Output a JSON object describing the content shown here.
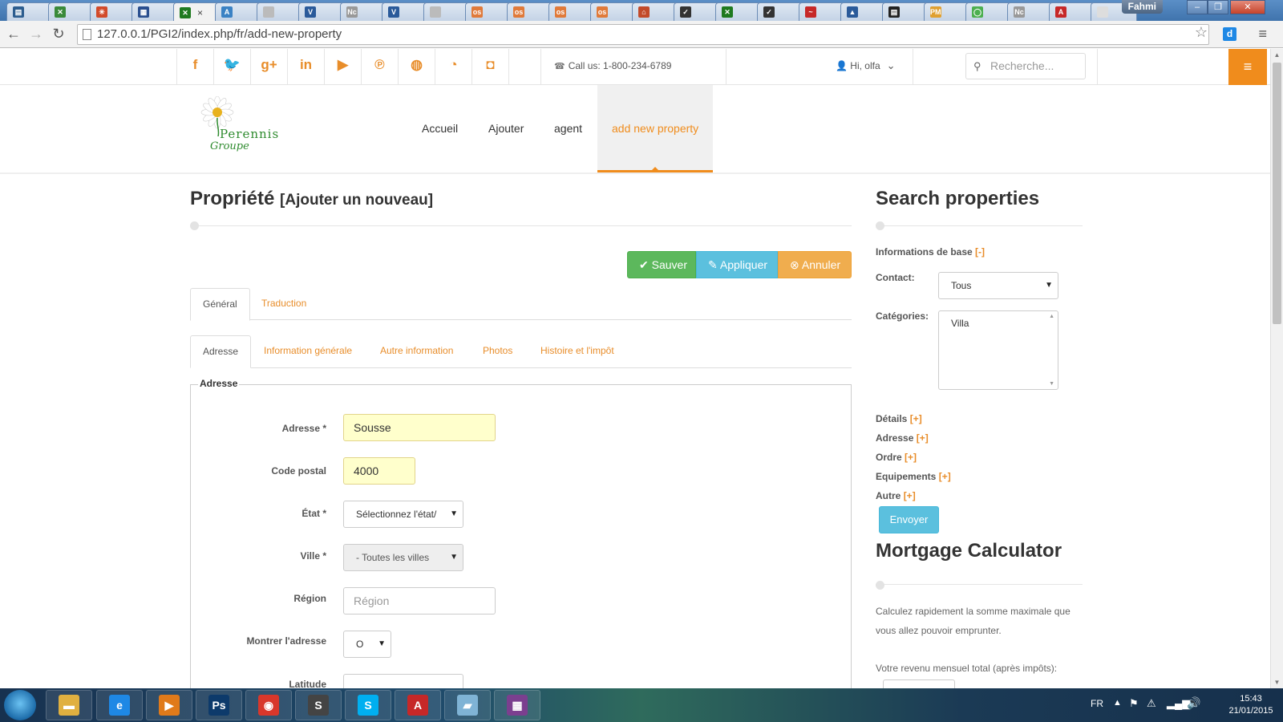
{
  "browser": {
    "url": "127.0.0.1/PGI2/index.php/fr/add-new-property",
    "user_badge": "Fahmi",
    "tabs": [
      {
        "icon": "page-icon",
        "color": "#2c5d8f",
        "glyph": "▤"
      },
      {
        "icon": "joomla-icon",
        "color": "#3a8a3a",
        "glyph": "✕"
      },
      {
        "icon": "joomla-icon",
        "color": "#d24a2a",
        "glyph": "✳"
      },
      {
        "icon": "grid-icon",
        "color": "#2a4f8f",
        "glyph": "▦"
      },
      {
        "icon": "joomla-icon",
        "color": "#1f7a1f",
        "glyph": "✕"
      },
      {
        "icon": "translate-icon",
        "color": "#3b82c4",
        "glyph": "A"
      },
      {
        "icon": "blank-page-icon",
        "color": "#bbbbbb",
        "glyph": ""
      },
      {
        "icon": "vsite-icon",
        "color": "#2a5a9a",
        "glyph": "V"
      },
      {
        "icon": "nc-icon",
        "color": "#999999",
        "glyph": "Nc"
      },
      {
        "icon": "vsite-icon",
        "color": "#2a5a9a",
        "glyph": "V"
      },
      {
        "icon": "blank-page-icon",
        "color": "#bbbbbb",
        "glyph": ""
      },
      {
        "icon": "os-icon",
        "color": "#e07a3a",
        "glyph": "os"
      },
      {
        "icon": "os-icon",
        "color": "#e07a3a",
        "glyph": "os"
      },
      {
        "icon": "os-icon",
        "color": "#e07a3a",
        "glyph": "os"
      },
      {
        "icon": "os-icon",
        "color": "#e07a3a",
        "glyph": "os"
      },
      {
        "icon": "home-icon",
        "color": "#c24a2a",
        "glyph": "⌂"
      },
      {
        "icon": "check-circle-icon",
        "color": "#333333",
        "glyph": "✓"
      },
      {
        "icon": "joomla-icon",
        "color": "#1f7a1f",
        "glyph": "✕"
      },
      {
        "icon": "check-circle-icon",
        "color": "#333333",
        "glyph": "✓"
      },
      {
        "icon": "wave-icon",
        "color": "#c62828",
        "glyph": "~"
      },
      {
        "icon": "triangle-icon",
        "color": "#2a5a9a",
        "glyph": "▲"
      },
      {
        "icon": "dark-page-icon",
        "color": "#222222",
        "glyph": "▤"
      },
      {
        "icon": "pma-icon",
        "color": "#e0a030",
        "glyph": "PMA"
      },
      {
        "icon": "ring-icon",
        "color": "#4caf50",
        "glyph": "◯"
      },
      {
        "icon": "nc-icon",
        "color": "#999999",
        "glyph": "Nc"
      },
      {
        "icon": "acrobat-icon",
        "color": "#c62828",
        "glyph": "A"
      },
      {
        "icon": "blank-tab-icon",
        "color": "#dddddd",
        "glyph": ""
      }
    ],
    "close_tab": "×"
  },
  "topbar": {
    "social": [
      {
        "name": "facebook-icon",
        "glyph": "f"
      },
      {
        "name": "twitter-icon",
        "glyph": "🐦"
      },
      {
        "name": "google-plus-icon",
        "glyph": "g+"
      },
      {
        "name": "linkedin-icon",
        "glyph": "in"
      },
      {
        "name": "youtube-icon",
        "glyph": "▶"
      },
      {
        "name": "pinterest-icon",
        "glyph": "℗"
      },
      {
        "name": "dribbble-icon",
        "glyph": "◍"
      },
      {
        "name": "rss-icon",
        "glyph": "◔"
      },
      {
        "name": "instagram-icon",
        "glyph": "◘"
      }
    ],
    "call_us": "Call us: 1-800-234-6789",
    "greeting": "Hi, olfa",
    "search_placeholder": "Recherche..."
  },
  "nav": {
    "items": [
      "Accueil",
      "Ajouter",
      "agent",
      "add new property"
    ],
    "logo_text_1": "Perennis",
    "logo_text_2": "Groupe"
  },
  "main": {
    "title": "Propriété",
    "subtitle": "[Ajouter un nouveau]",
    "buttons": {
      "save": "Sauver",
      "apply": "Appliquer",
      "cancel": "Annuler"
    },
    "tabs": [
      "Général",
      "Traduction"
    ],
    "subtabs": [
      "Adresse",
      "Information générale",
      "Autre information",
      "Photos",
      "Histoire et l'impôt"
    ],
    "fieldset_legend": "Adresse",
    "fields": {
      "address": {
        "label": "Adresse *",
        "value": "Sousse"
      },
      "postal": {
        "label": "Code postal",
        "value": "4000"
      },
      "state": {
        "label": "État *",
        "value": "Sélectionnez l'état/"
      },
      "city": {
        "label": "Ville *",
        "value": "- Toutes les villes"
      },
      "region": {
        "label": "Région",
        "placeholder": "Région"
      },
      "show_address": {
        "label": "Montrer l'adresse",
        "value": "O"
      },
      "latitude": {
        "label": "Latitude"
      }
    }
  },
  "sidebar": {
    "title": "Search properties",
    "basic_info": "Informations de base",
    "basic_toggle": "[-]",
    "contact_label": "Contact:",
    "contact_value": "Tous",
    "categories_label": "Catégories:",
    "categories_value": "Villa",
    "sections": [
      {
        "label": "Détails",
        "toggle": "[+]"
      },
      {
        "label": "Adresse",
        "toggle": "[+]"
      },
      {
        "label": "Ordre",
        "toggle": "[+]"
      },
      {
        "label": "Equipements",
        "toggle": "[+]"
      },
      {
        "label": "Autre",
        "toggle": "[+]"
      }
    ],
    "submit": "Envoyer",
    "mortgage_title": "Mortgage Calculator",
    "mortgage_text_1": "Calculez rapidement la somme maximale que",
    "mortgage_text_2": "vous allez pouvoir emprunter.",
    "income_label": "Votre revenu mensuel total (après impôts):"
  },
  "taskbar": {
    "apps": [
      {
        "name": "explorer-icon",
        "color": "#e0b040",
        "glyph": "▬"
      },
      {
        "name": "ie-icon",
        "color": "#1e88e5",
        "glyph": "e"
      },
      {
        "name": "media-player-icon",
        "color": "#e07a1a",
        "glyph": "▶"
      },
      {
        "name": "photoshop-icon",
        "color": "#0d3a6b",
        "glyph": "Ps"
      },
      {
        "name": "chrome-icon",
        "color": "#d8372b",
        "glyph": "◉"
      },
      {
        "name": "sublime-icon",
        "color": "#444444",
        "glyph": "S"
      },
      {
        "name": "skype-icon",
        "color": "#00aff0",
        "glyph": "S"
      },
      {
        "name": "acrobat-icon",
        "color": "#c62828",
        "glyph": "A"
      },
      {
        "name": "notepad-icon",
        "color": "#7fb3d5",
        "glyph": "▰"
      },
      {
        "name": "winrar-icon",
        "color": "#7b3f8f",
        "glyph": "▦"
      }
    ],
    "lang": "FR",
    "time": "15:43",
    "date": "21/01/2015"
  }
}
